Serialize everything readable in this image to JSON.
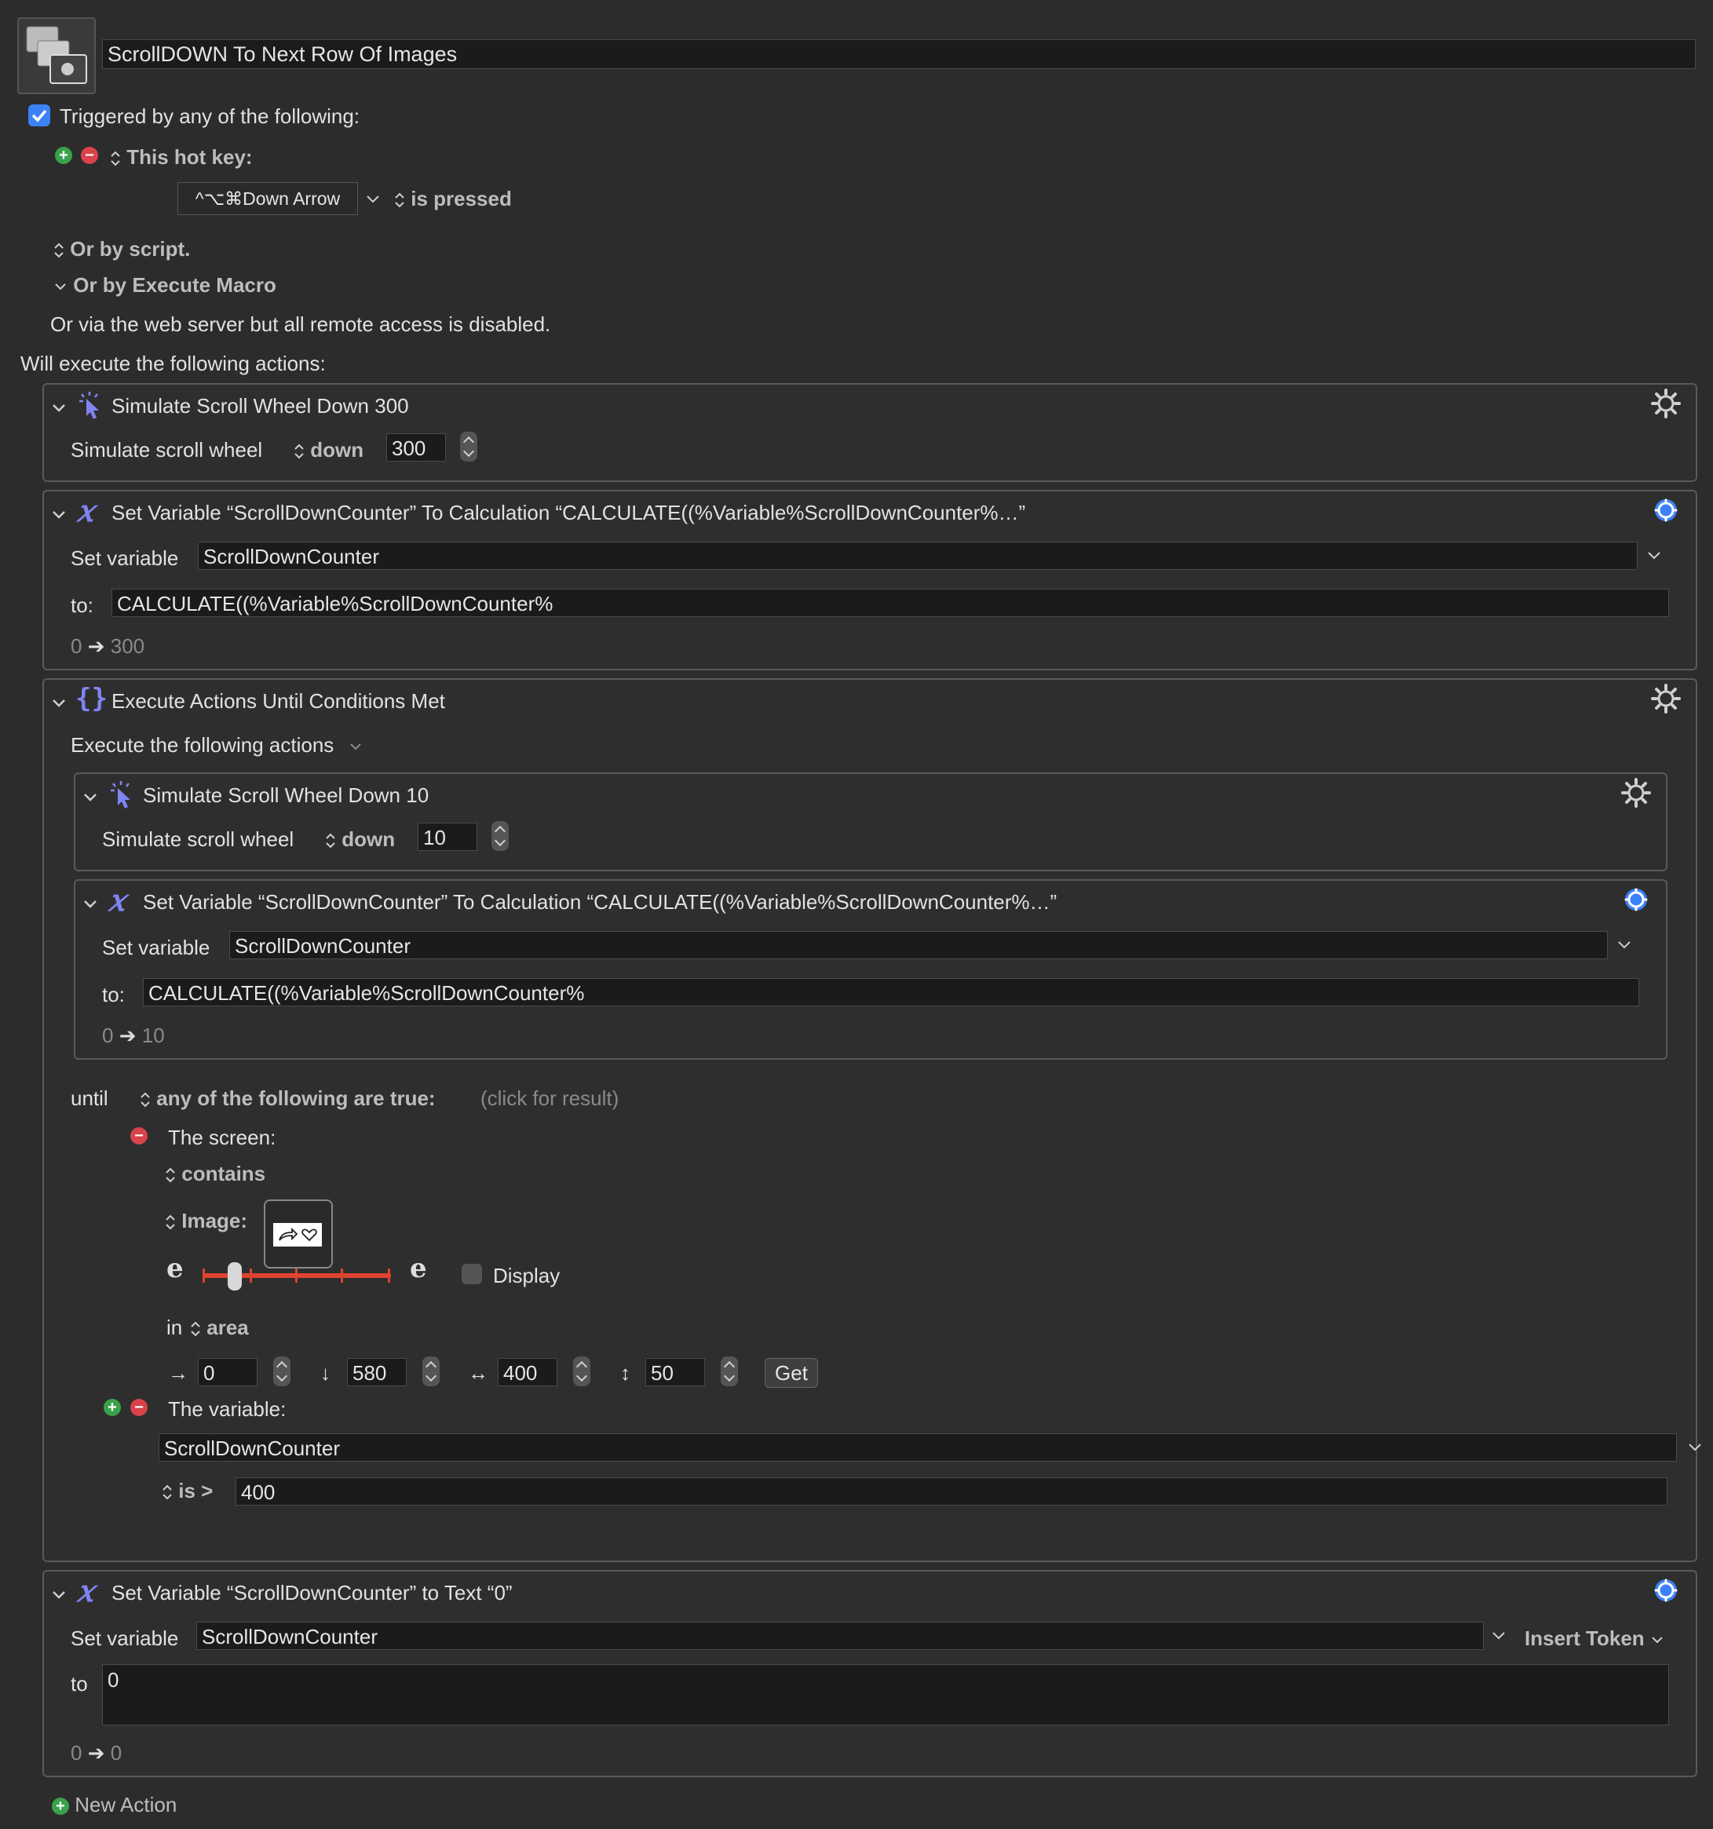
{
  "macro": {
    "title": "ScrollDOWN To Next Row Of Images"
  },
  "trigger": {
    "checkbox_label": "Triggered by any of the following:",
    "hotkey_label": "This hot key:",
    "hotkey_value": "^⌥⌘Down Arrow",
    "pressed_label": "is pressed",
    "by_script": "Or by script.",
    "by_execute": "Or by Execute Macro",
    "web_server": "Or via the web server but all remote access is disabled."
  },
  "actions_header": "Will execute the following actions:",
  "action1": {
    "title": "Simulate Scroll Wheel Down 300",
    "label": "Simulate scroll wheel",
    "direction": "down",
    "amount": "300"
  },
  "action2": {
    "title": "Set Variable “ScrollDownCounter” To Calculation “CALCULATE((%Variable%ScrollDownCounter%…”",
    "set_label": "Set variable",
    "variable": "ScrollDownCounter",
    "to_label": "to:",
    "value": "CALCULATE((%Variable%ScrollDownCounter%",
    "preview_from": "0",
    "preview_to": "300"
  },
  "action3": {
    "title": "Execute Actions Until Conditions Met",
    "execute_label": "Execute the following actions",
    "sub1": {
      "title": "Simulate Scroll Wheel Down 10",
      "label": "Simulate scroll wheel",
      "direction": "down",
      "amount": "10"
    },
    "sub2": {
      "title": "Set Variable “ScrollDownCounter” To Calculation “CALCULATE((%Variable%ScrollDownCounter%…”",
      "set_label": "Set variable",
      "variable": "ScrollDownCounter",
      "to_label": "to:",
      "value": "CALCULATE((%Variable%ScrollDownCounter%",
      "preview_from": "0",
      "preview_to": "10"
    },
    "until_label": "until",
    "any_label": "any of the following are true:",
    "click_result": "(click for result)",
    "screen_label": "The screen:",
    "contains_label": "contains",
    "image_label": "Image:",
    "fuzz_left": "e",
    "fuzz_right": "e",
    "display_label": "Display",
    "in_label": "in",
    "area_label": "area",
    "area": {
      "x": "0",
      "y": "580",
      "w": "400",
      "h": "50"
    },
    "get_label": "Get",
    "variable_cond_label": "The variable:",
    "variable_cond_name": "ScrollDownCounter",
    "is_label": "is >",
    "is_value": "400"
  },
  "action4": {
    "title": "Set Variable “ScrollDownCounter” to Text “0”",
    "set_label": "Set variable",
    "variable": "ScrollDownCounter",
    "insert_token": "Insert Token",
    "to_label": "to",
    "value": "0",
    "preview_from": "0",
    "preview_to": "0"
  },
  "new_action": "New Action",
  "colors": {
    "background": "#2c2c2c",
    "accent_blue": "#3b82f6",
    "icon_purple": "#7f84f2",
    "slider_red": "#e0432e"
  }
}
